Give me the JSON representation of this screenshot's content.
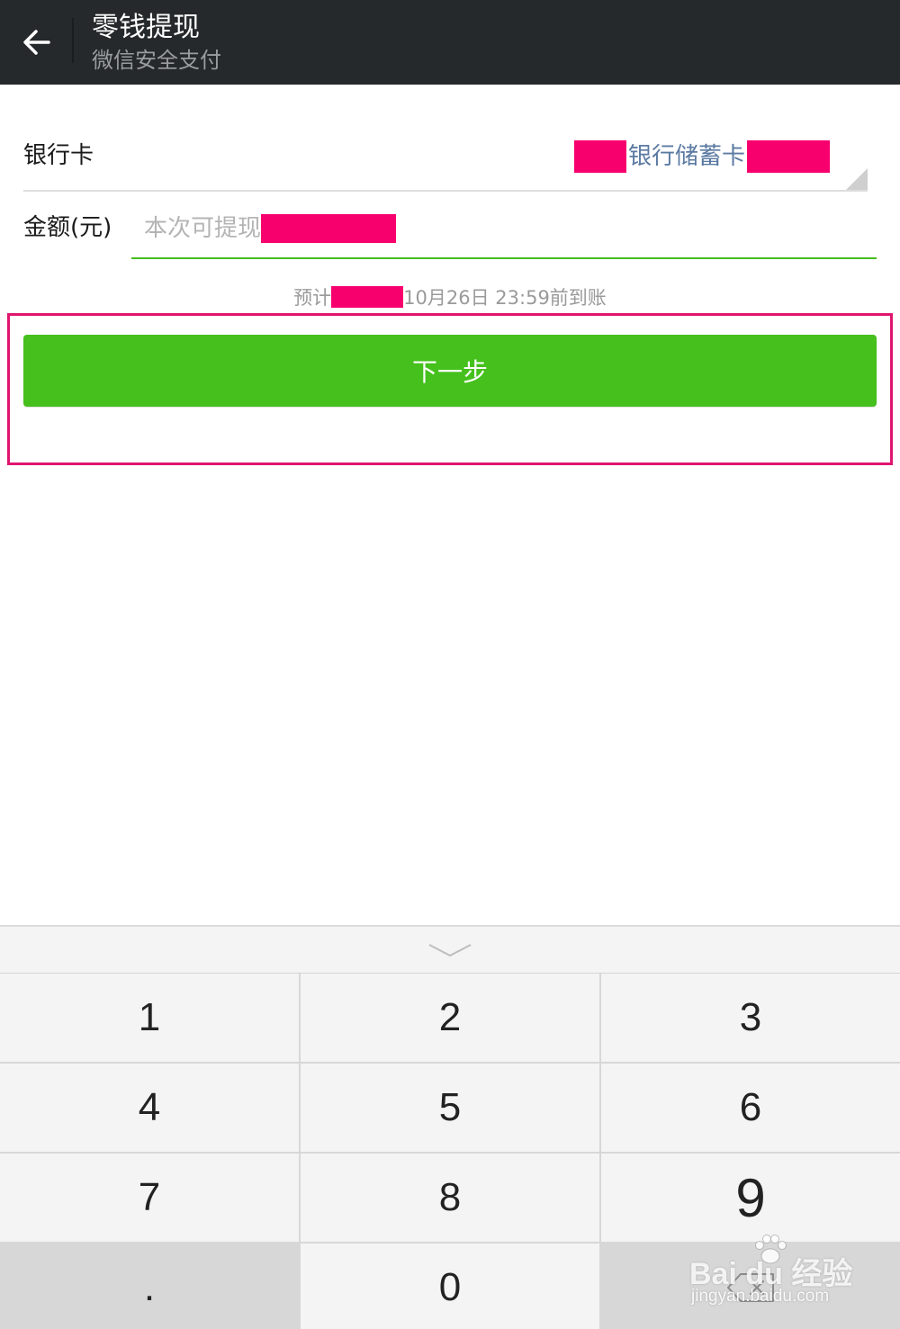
{
  "header": {
    "title": "零钱提现",
    "subtitle": "微信安全支付",
    "back_icon": "arrow-left-icon"
  },
  "bank_card": {
    "label": "银行卡",
    "value": "银行储蓄卡"
  },
  "amount": {
    "label": "金额(元)",
    "placeholder": "本次可提现"
  },
  "arrival": {
    "prefix": "预计",
    "suffix": "10月26日 23:59前到账"
  },
  "next_button": {
    "label": "下一步"
  },
  "keypad": {
    "collapse_icon": "chevron-down-icon",
    "keys": [
      "1",
      "2",
      "3",
      "4",
      "5",
      "6",
      "7",
      "8",
      "9",
      ".",
      "0"
    ],
    "delete_icon": "backspace-icon"
  },
  "watermark": {
    "brand": "Bai du 经验",
    "url": "jingyan.baidu.com"
  },
  "colors": {
    "titlebar": "#26292b",
    "accent_green": "#45c01c",
    "redaction": "#f7006e",
    "highlight_frame": "#e0156f",
    "card_text": "#5b7aa2"
  }
}
